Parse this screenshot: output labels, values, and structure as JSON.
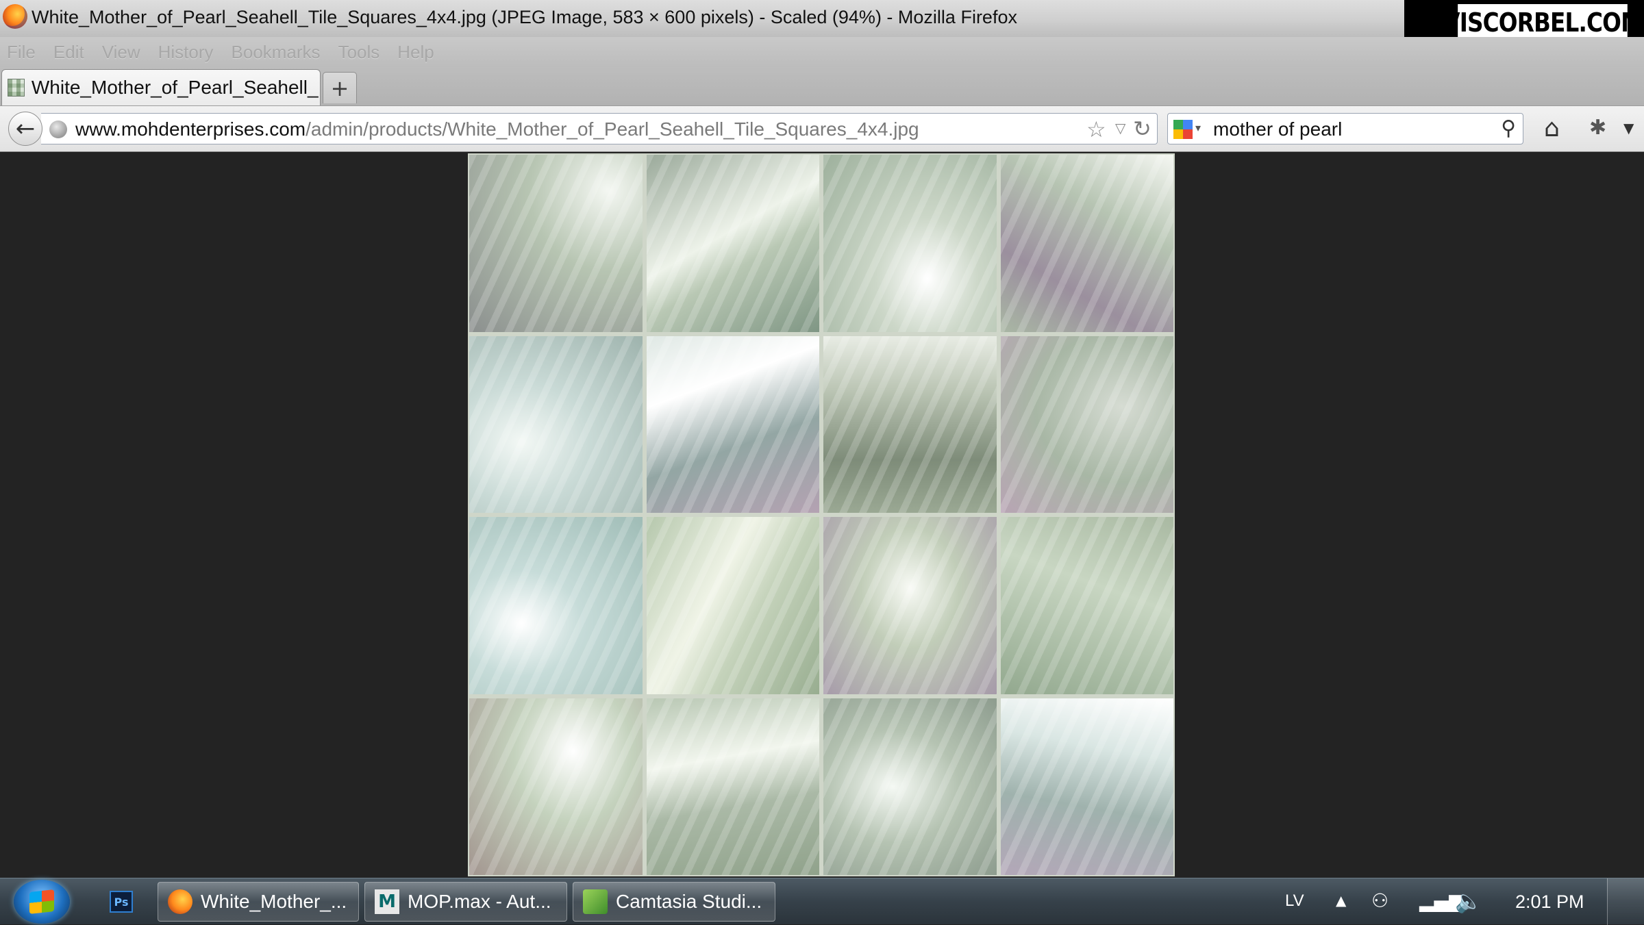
{
  "window": {
    "title": "White_Mother_of_Pearl_Seahell_Tile_Squares_4x4.jpg (JPEG Image, 583 × 600 pixels) - Scaled (94%) - Mozilla Firefox",
    "brand_watermark": "VISCORBEL.COM"
  },
  "menubar": {
    "items": [
      "File",
      "Edit",
      "View",
      "History",
      "Bookmarks",
      "Tools",
      "Help"
    ]
  },
  "tabs": [
    {
      "label": "White_Mother_of_Pearl_Seahell_...",
      "active": true
    }
  ],
  "newtab_label": "+",
  "navbar": {
    "url_host": "www.mohdenterprises.com",
    "url_path": "/admin/products/White_Mother_of_Pearl_Seahell_Tile_Squares_4x4.jpg",
    "search_query": "mother of pearl"
  },
  "content": {
    "image_description_name": "mother-of-pearl tile grid",
    "grid": {
      "rows": 4,
      "cols": 4
    }
  },
  "taskbar": {
    "pinned": [
      {
        "icon": "photoshop-icon",
        "label": "Ps"
      }
    ],
    "tasks": [
      {
        "icon": "firefox-icon",
        "label": "White_Mother_..."
      },
      {
        "icon": "3dsmax-icon",
        "icon_text": "M",
        "label": "MOP.max - Aut..."
      },
      {
        "icon": "camtasia-icon",
        "label": "Camtasia Studi..."
      }
    ],
    "tray": {
      "language": "LV",
      "clock": "2:01 PM"
    }
  },
  "colors": {
    "content_bg": "#232323",
    "taskbar": "#36414a",
    "accent": "#2f7fd1"
  }
}
